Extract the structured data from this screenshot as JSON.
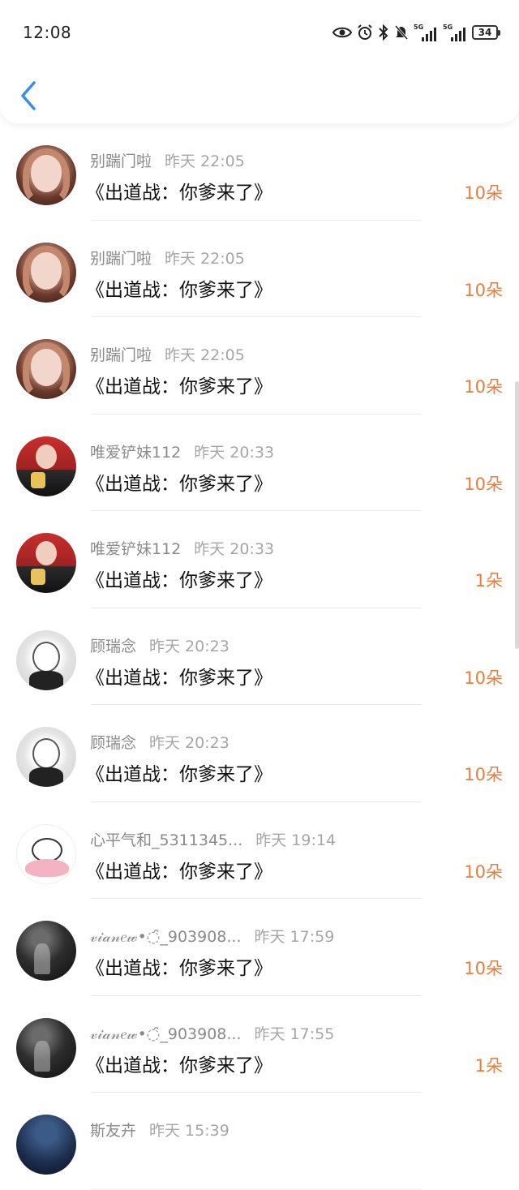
{
  "status_bar": {
    "time": "12:08",
    "signal1_label": "5G",
    "signal2_label": "5G",
    "battery": "34"
  },
  "colors": {
    "accent_blue": "#3a8ee6",
    "count_orange": "#ec7c3a"
  },
  "items": [
    {
      "name": "别踹门啦",
      "time": "昨天 22:05",
      "title": "《出道战：你爹来了》",
      "count": "10朵",
      "avatar": "girl"
    },
    {
      "name": "别踹门啦",
      "time": "昨天 22:05",
      "title": "《出道战：你爹来了》",
      "count": "10朵",
      "avatar": "girl"
    },
    {
      "name": "别踹门啦",
      "time": "昨天 22:05",
      "title": "《出道战：你爹来了》",
      "count": "10朵",
      "avatar": "girl"
    },
    {
      "name": "唯爱铲妹112",
      "time": "昨天 20:33",
      "title": "《出道战：你爹来了》",
      "count": "10朵",
      "avatar": "boy"
    },
    {
      "name": "唯爱铲妹112",
      "time": "昨天 20:33",
      "title": "《出道战：你爹来了》",
      "count": "1朵",
      "avatar": "boy"
    },
    {
      "name": "顾瑞念",
      "time": "昨天 20:23",
      "title": "《出道战：你爹来了》",
      "count": "10朵",
      "avatar": "anime"
    },
    {
      "name": "顾瑞念",
      "time": "昨天 20:23",
      "title": "《出道战：你爹来了》",
      "count": "10朵",
      "avatar": "anime"
    },
    {
      "name": "心平气和_5311345...",
      "time": "昨天 19:14",
      "title": "《出道战：你爹来了》",
      "count": "10朵",
      "avatar": "kitty"
    },
    {
      "name": "𝓋𝒾𝒶𝓃𝑒𝓌•◌̑_903908...",
      "time": "昨天 17:59",
      "title": "《出道战：你爹来了》",
      "count": "10朵",
      "avatar": "dark"
    },
    {
      "name": "𝓋𝒾𝒶𝓃𝑒𝓌•◌̑_903908...",
      "time": "昨天 17:55",
      "title": "《出道战：你爹来了》",
      "count": "1朵",
      "avatar": "dark"
    },
    {
      "name": "斯友卉",
      "time": "昨天 15:39",
      "title": "",
      "count": "",
      "avatar": "night"
    }
  ]
}
